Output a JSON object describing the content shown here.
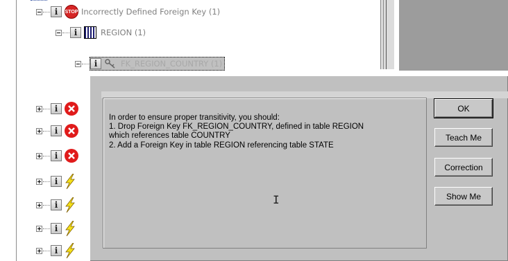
{
  "tree": {
    "rows": [
      {
        "label": "Incorrectly Defined Foreign Key (1)",
        "icon": "stop-icon",
        "stop_text": "STOP"
      },
      {
        "label": "REGION (1)",
        "icon": "table-icon"
      },
      {
        "label": "FK_REGION_COUNTRY (1)",
        "icon": "key-icon"
      }
    ],
    "collapsed_items": [
      {
        "icon": "error-x-icon"
      },
      {
        "icon": "error-x-icon"
      },
      {
        "icon": "error-x-icon"
      },
      {
        "icon": "lightning-icon"
      },
      {
        "icon": "lightning-icon"
      },
      {
        "icon": "lightning-icon"
      },
      {
        "icon": "lightning-icon"
      }
    ]
  },
  "dialog": {
    "message_lines": [
      "In order to ensure proper transitivity, you should:",
      "1. Drop Foreign Key FK_REGION_COUNTRY, defined in table REGION",
      "which references table COUNTRY",
      "2. Add a Foreign Key in table REGION referencing table STATE"
    ],
    "buttons": {
      "ok": "OK",
      "teach_me": "Teach Me",
      "correction": "Correction",
      "show_me": "Show Me"
    }
  },
  "colors": {
    "dialog_bg": "#c0c0c0",
    "error_red": "#e01b1b",
    "lightning_yellow": "#f5e11a"
  }
}
